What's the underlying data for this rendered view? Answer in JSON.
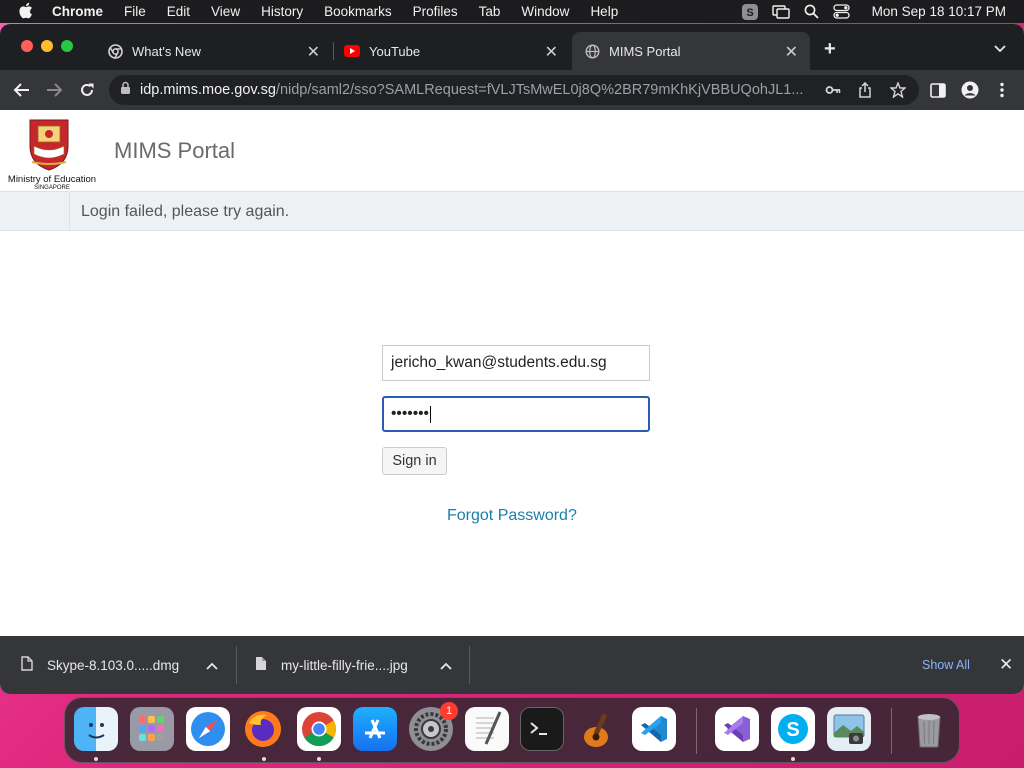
{
  "menubar": {
    "app_name": "Chrome",
    "menus": [
      "File",
      "Edit",
      "View",
      "History",
      "Bookmarks",
      "Profiles",
      "Tab",
      "Window",
      "Help"
    ],
    "clock": "Mon Sep 18  10:17 PM"
  },
  "tabs": [
    {
      "title": "What's New",
      "icon": "chrome-icon"
    },
    {
      "title": "YouTube",
      "icon": "youtube-icon"
    },
    {
      "title": "MIMS Portal",
      "icon": "globe-icon",
      "active": true
    }
  ],
  "address_bar": {
    "host": "idp.mims.moe.gov.sg",
    "path": "/nidp/saml2/sso?SAMLRequest=fVLJTsMwEL0j8Q%2BR79mKhKjVBBUQohJL1..."
  },
  "page": {
    "logo_line1": "Ministry of Education",
    "logo_line2": "SINGAPORE",
    "portal_title": "MIMS Portal",
    "alert": "Login failed, please try again.",
    "username_value": "jericho_kwan@students.edu.sg",
    "password_mask": "•••••••",
    "signin_label": "Sign in",
    "forgot_label": "Forgot Password?"
  },
  "downloads": {
    "items": [
      {
        "filename": "Skype-8.103.0.....dmg"
      },
      {
        "filename": "my-little-filly-frie....jpg"
      }
    ],
    "show_all": "Show All"
  },
  "dock": {
    "apps": [
      "Finder",
      "Launchpad",
      "Safari",
      "Firefox",
      "Chrome",
      "App Store",
      "System Settings",
      "TextEdit",
      "Terminal",
      "GarageBand",
      "Visual Studio Code",
      "Visual Studio",
      "Skype",
      "Preview",
      "Trash"
    ],
    "settings_badge": "1"
  },
  "colors": {
    "accent_link": "#1a7fa8",
    "focus_border": "#2a5db0",
    "tab_bg": "#1e1f22",
    "toolbar_bg": "#35363a"
  }
}
